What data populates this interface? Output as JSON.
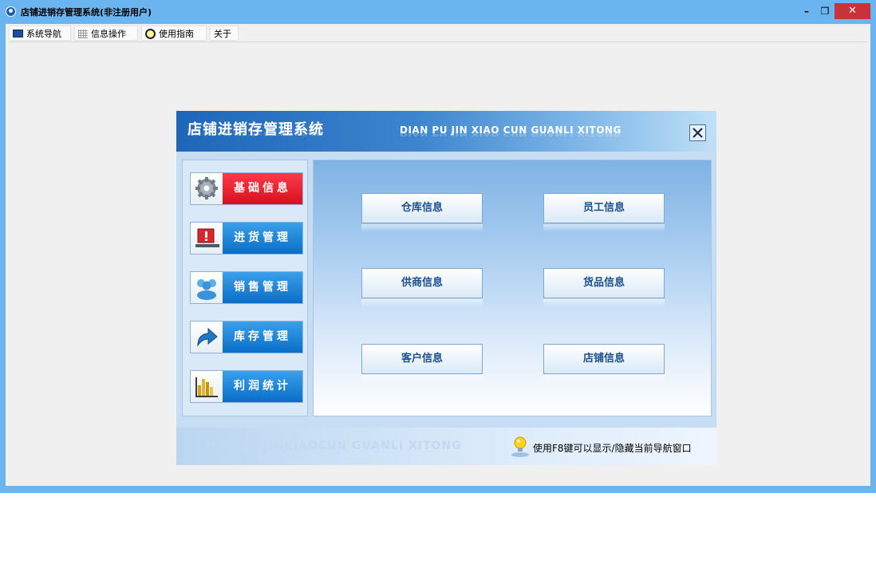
{
  "window": {
    "title": "店铺进销存管理系统(非注册用户)",
    "minimize_label": "–",
    "maximize_label": "❐",
    "close_label": "✕"
  },
  "menubar": {
    "items": [
      {
        "label": "系统导航",
        "icon": "monitor-icon"
      },
      {
        "label": "信息操作",
        "icon": "grid-icon"
      },
      {
        "label": "使用指南",
        "icon": "clock-icon"
      },
      {
        "label": "关于",
        "icon": ""
      }
    ]
  },
  "panel": {
    "title": "店铺进销存管理系统",
    "subtitle": "DIAN PU JIN XIAO CUN GUANLI XITONG",
    "close_icon": "close-icon",
    "nav": [
      {
        "label": "基础信息",
        "icon": "gear-icon",
        "active": true
      },
      {
        "label": "进货管理",
        "icon": "alert-monitor-icon",
        "active": false
      },
      {
        "label": "销售管理",
        "icon": "users-icon",
        "active": false
      },
      {
        "label": "库存管理",
        "icon": "arrow-icon",
        "active": false
      },
      {
        "label": "利润统计",
        "icon": "bar-chart-icon",
        "active": false
      }
    ],
    "buttons": [
      {
        "label": "仓库信息"
      },
      {
        "label": "员工信息"
      },
      {
        "label": "供商信息"
      },
      {
        "label": "货品信息"
      },
      {
        "label": "客户信息"
      },
      {
        "label": "店铺信息"
      }
    ],
    "footer": {
      "watermark": "DIANPU JINXIAOCUN GUANLI XITONG",
      "tip": "使用F8键可以显示/隐藏当前导航窗口",
      "tip_icon": "lightbulb-icon"
    }
  },
  "colors": {
    "titlebar": "#6ab5f0",
    "nav_active": "#e0192b",
    "nav_inactive": "#1a86dc",
    "close_button": "#c8333a"
  }
}
